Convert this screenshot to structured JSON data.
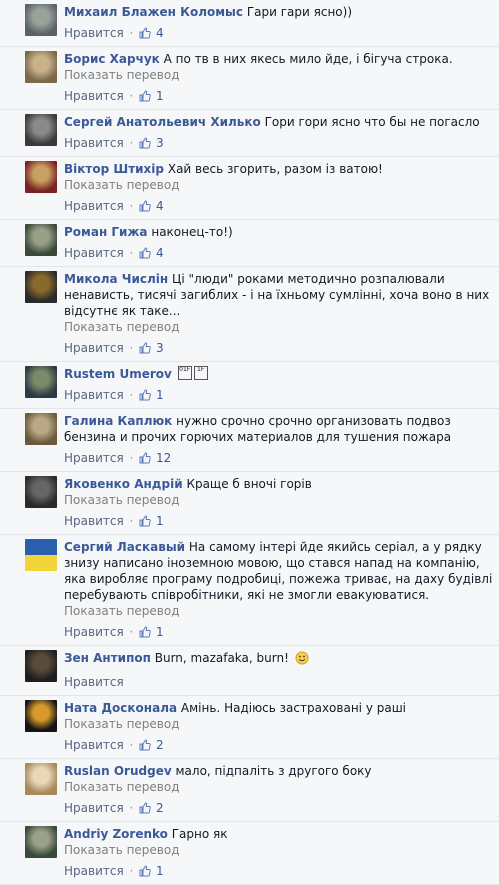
{
  "ui": {
    "like_label": "Нравится",
    "translate_label": "Показать перевод"
  },
  "comments": [
    {
      "author": "Михаил Блажен Коломыс",
      "text": "Гари гари ясно))",
      "translate": false,
      "likes": "4"
    },
    {
      "author": "Борис Харчук",
      "text": "А по тв в них якесь мило йде, і бігуча строка.",
      "translate": true,
      "likes": "1"
    },
    {
      "author": "Сергей Анатольевич Хилько",
      "text": "Гори гори ясно что бы не погасло",
      "translate": false,
      "likes": "3"
    },
    {
      "author": "Віктор Штихір",
      "text": "Хай весь згорить, разом із ватою!",
      "translate": true,
      "likes": "4"
    },
    {
      "author": "Роман Гижа",
      "text": "наконец-то!)",
      "translate": false,
      "likes": "4"
    },
    {
      "author": "Микола Числін",
      "text": "Ці \"люди\" роками методично розпалювали ненависть, тисячі загиблих - і на їхньому сумлінні, хоча воно в них відсутнє як таке...",
      "translate": true,
      "likes": "3"
    },
    {
      "author": "Rustem Umerov",
      "text": "",
      "translate": false,
      "likes": "1",
      "emoji": "boxes"
    },
    {
      "author": "Галина Каплюк",
      "text": "нужно срочно срочно организовать подвоз бензина и прочих горючих материалов для тушения пожара",
      "translate": false,
      "likes": "12"
    },
    {
      "author": "Яковенко Андрій",
      "text": "Краще б вночі горів",
      "translate": true,
      "likes": "1"
    },
    {
      "author": "Сергий Ласкавый",
      "text": "На самому інтері йде якийсь серіал, а у рядку знизу написано іноземною мовою, що стався напад на компанію, яка виробляє програму подробиці, пожежа триває, на даху будівлі перебувають співробітники, які не змогли евакуюватися.",
      "translate": true,
      "likes": "1"
    },
    {
      "author": "Зен Антипоп",
      "text": "Burn, mazafaka, burn!",
      "translate": false,
      "likes": "",
      "emoji": "smile"
    },
    {
      "author": "Ната Досконала",
      "text": "Амінь. Надіюсь застраховані у раші",
      "translate": true,
      "likes": "2"
    },
    {
      "author": "Ruslan Orudgev",
      "text": "мало, підпаліть з другого боку",
      "translate": true,
      "likes": "2"
    },
    {
      "author": "Andriy Zorenko",
      "text": "Гарно як",
      "translate": true,
      "likes": "1"
    }
  ],
  "emoji_box_glyphs": [
    "01F",
    "1F"
  ],
  "colors": {
    "author": "#3b5998",
    "text": "#141823",
    "muted": "#7f7f7f",
    "background": "#f6f7f9"
  }
}
